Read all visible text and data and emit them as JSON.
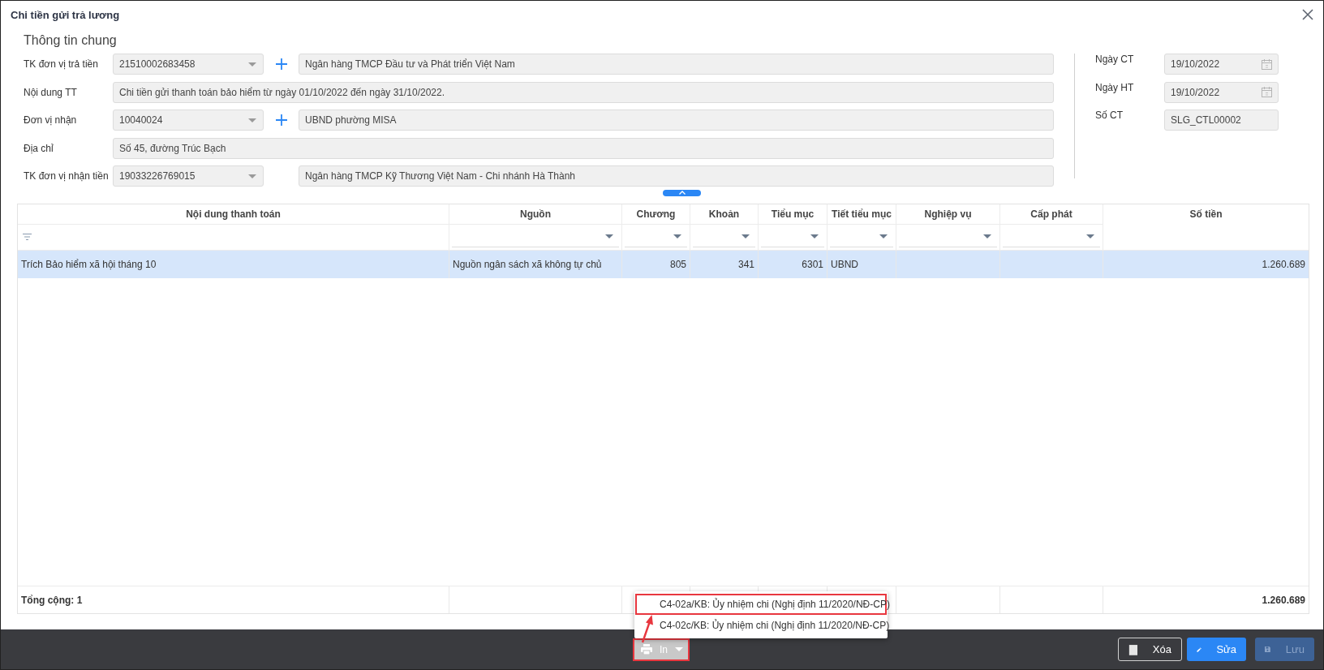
{
  "dialog": {
    "title": "Chi tiền gửi trả lương"
  },
  "general_info": {
    "heading": "Thông tin chung",
    "rows": [
      {
        "label": "TK đơn vị trả tiền",
        "kind": "combo",
        "value": "21510002683458",
        "add_button": true,
        "detail": "Ngân hàng TMCP Đầu tư và Phát triển Việt Nam"
      },
      {
        "label": "Nội dung TT",
        "kind": "text",
        "value": "Chi tiền gửi thanh toán bảo hiểm từ ngày 01/10/2022 đến ngày 31/10/2022."
      },
      {
        "label": "Đơn vị nhận",
        "kind": "combo",
        "value": "10040024",
        "add_button": true,
        "detail": "UBND phường MISA"
      },
      {
        "label": "Địa chỉ",
        "kind": "text",
        "value": "Số 45, đường Trúc Bạch"
      },
      {
        "label": "TK đơn vị nhận tiền",
        "kind": "combo",
        "value": "19033226769015",
        "add_button": false,
        "detail": "Ngân hàng TMCP Kỹ Thương Việt Nam - Chi nhánh Hà Thành"
      }
    ]
  },
  "voucher_info": [
    {
      "label": "Ngày CT",
      "kind": "date",
      "value": "19/10/2022"
    },
    {
      "label": "Ngày HT",
      "kind": "date",
      "value": "19/10/2022"
    },
    {
      "label": "Số CT",
      "kind": "text",
      "value": "SLG_CTL00002"
    }
  ],
  "table": {
    "columns": [
      {
        "header": "Nội dung thanh toán",
        "kind": "lead"
      },
      {
        "header": "Nguồn",
        "kind": "list"
      },
      {
        "header": "Chương",
        "kind": "number"
      },
      {
        "header": "Khoản",
        "kind": "number"
      },
      {
        "header": "Tiểu mục",
        "kind": "number"
      },
      {
        "header": "Tiết tiểu mục",
        "kind": "list"
      },
      {
        "header": "Nghiệp vụ",
        "kind": "list"
      },
      {
        "header": "Cấp phát",
        "kind": "list"
      },
      {
        "header": "Số tiền",
        "kind": "amount"
      }
    ],
    "rows": [
      {
        "selected": true,
        "cells": [
          "Trích Bảo hiểm xã hội tháng 10",
          "Nguồn ngân sách xã không tự chủ",
          "805",
          "341",
          "6301",
          "UBND",
          "",
          "",
          "1.260.689"
        ]
      }
    ],
    "footer": {
      "label": "Tổng cộng: 1",
      "total": "1.260.689"
    }
  },
  "print_menu": {
    "items": [
      {
        "label": "C4-02a/KB: Ủy nhiệm chi (Nghị định 11/2020/NĐ-CP)",
        "annotated": true
      },
      {
        "label": "C4-02c/KB: Ủy nhiệm chi (Nghị định 11/2020/NĐ-CP)",
        "annotated": false
      }
    ]
  },
  "toolbar": {
    "print": {
      "label": "In",
      "annotated": true
    },
    "buttons": [
      {
        "label": "Xóa",
        "kind": "delete",
        "disabled": false
      },
      {
        "label": "Sửa",
        "kind": "edit",
        "disabled": false
      },
      {
        "label": "Lưu",
        "kind": "save",
        "disabled": true
      }
    ]
  }
}
